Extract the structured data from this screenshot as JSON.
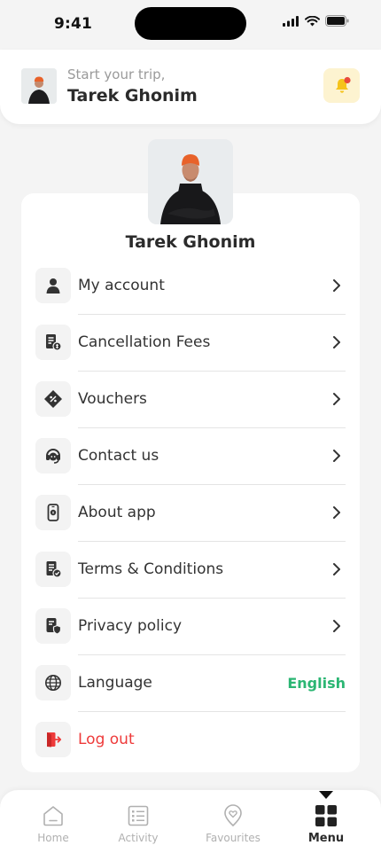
{
  "status_bar": {
    "time": "9:41"
  },
  "header": {
    "subtitle": "Start your trip,",
    "name": "Tarek Ghonim"
  },
  "profile": {
    "name": "Tarek Ghonim"
  },
  "menu": [
    {
      "label": "My account",
      "icon": "user-icon"
    },
    {
      "label": "Cancellation Fees",
      "icon": "receipt-icon"
    },
    {
      "label": "Vouchers",
      "icon": "voucher-icon"
    },
    {
      "label": "Contact us",
      "icon": "headset-icon"
    },
    {
      "label": "About app",
      "icon": "phone-info-icon"
    },
    {
      "label": "Terms & Conditions",
      "icon": "document-check-icon"
    },
    {
      "label": "Privacy policy",
      "icon": "privacy-icon"
    },
    {
      "label": "Language",
      "icon": "globe-icon",
      "value": "English"
    },
    {
      "label": "Log out",
      "icon": "logout-icon"
    }
  ],
  "bottom_nav": [
    {
      "label": "Home",
      "icon": "home-icon"
    },
    {
      "label": "Activity",
      "icon": "list-icon"
    },
    {
      "label": "Favourites",
      "icon": "heart-pin-icon"
    },
    {
      "label": "Menu",
      "icon": "grid-icon",
      "active": true
    }
  ],
  "colors": {
    "accent_green": "#2bb673",
    "danger_red": "#ee3a3a",
    "bell_bg": "#fdf3d0",
    "bell_yellow": "#f5c31b",
    "notification_dot": "#e84a3c"
  }
}
